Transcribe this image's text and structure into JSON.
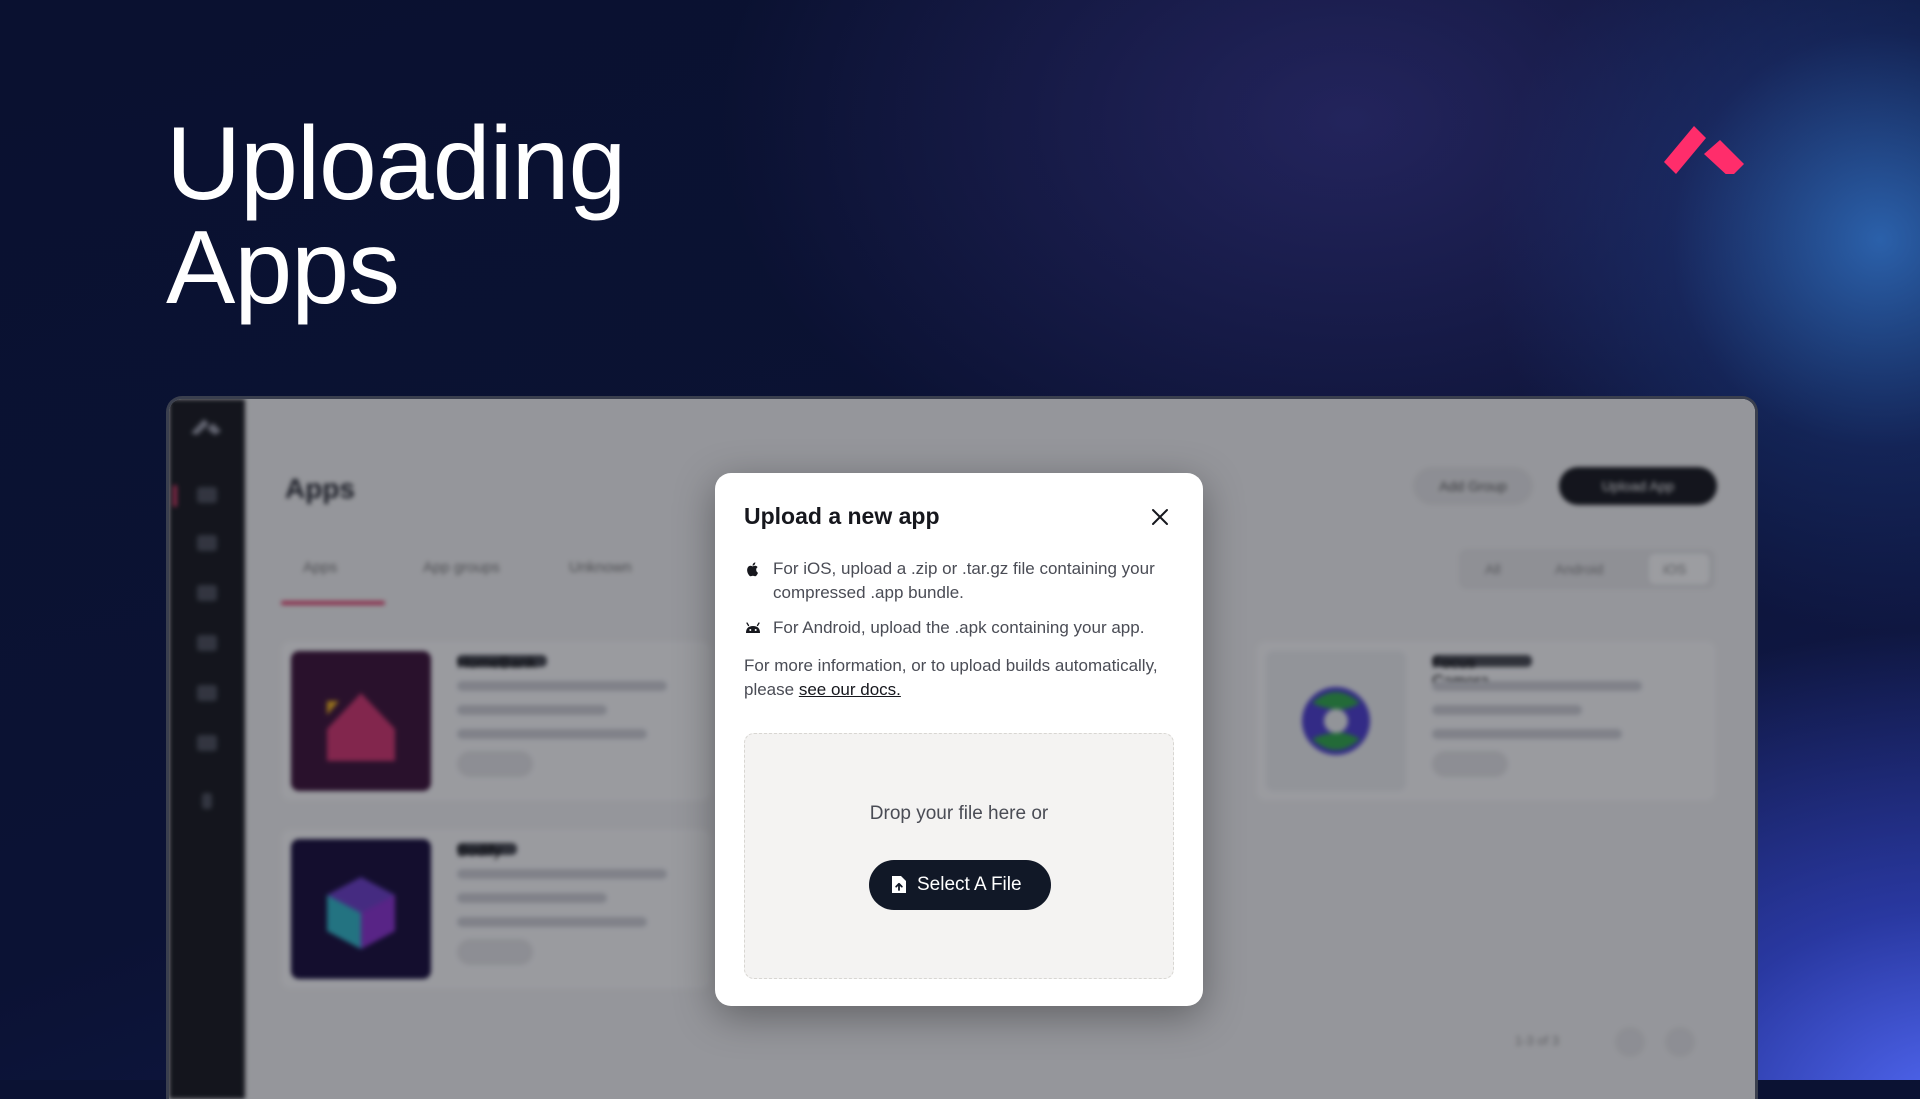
{
  "hero": {
    "title": "Uploading\nApps"
  },
  "colors": {
    "brand": "#ff2d6b",
    "accent": "#e03a68",
    "button_dark": "#111827"
  },
  "background_app": {
    "page_title": "Apps",
    "buttons": {
      "add_group": "Add Group",
      "upload_app": "Upload App"
    },
    "tabs": [
      "Apps",
      "App groups",
      "Unknown"
    ],
    "platform_filters": [
      "All",
      "Android",
      "iOS"
    ],
    "apps": [
      "HomeBank",
      "Bodify",
      "Focus Camera"
    ],
    "pagination": "1-3 of 3"
  },
  "modal": {
    "title": "Upload a new app",
    "close_icon": "close-icon",
    "ios_icon": "apple-icon",
    "android_icon": "android-icon",
    "ios_text": "For iOS, upload a .zip or .tar.gz file containing your compressed .app bundle.",
    "android_text": "For Android, upload the .apk containing your app.",
    "more_info_prefix": "For more information, or to upload builds automatically, please ",
    "docs_link": "see our docs.",
    "drop_text": "Drop your file here or",
    "select_button": "Select A File",
    "select_icon": "file-upload-icon"
  }
}
